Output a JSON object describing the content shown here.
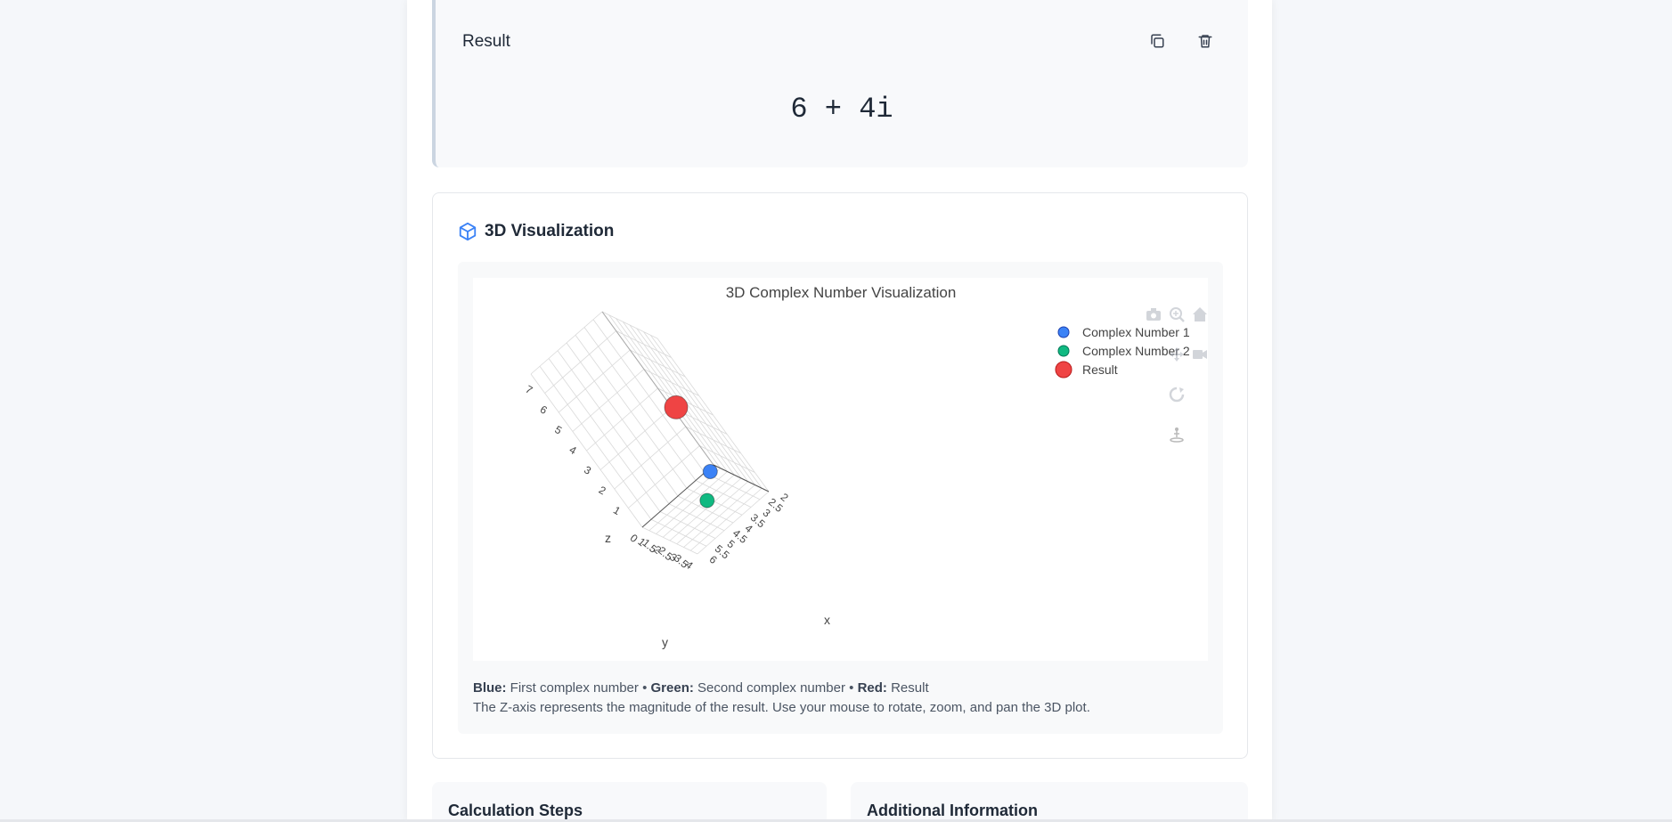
{
  "result": {
    "title": "Result",
    "value": "6 + 4i",
    "copy_icon": "copy-icon",
    "delete_icon": "trash-icon"
  },
  "visualization": {
    "title": "3D Visualization",
    "icon": "cube-icon",
    "caption": {
      "blue_label": "Blue:",
      "blue_text": "First complex number",
      "green_label": "Green:",
      "green_text": "Second complex number",
      "red_label": "Red:",
      "red_text": "Result",
      "separator": "•",
      "line2": "The Z-axis represents the magnitude of the result. Use your mouse to rotate, zoom, and pan the 3D plot."
    },
    "modebar": [
      "camera-icon",
      "zoom-icon",
      "home-icon",
      "pan-icon",
      "orbit-camera-icon",
      "turntable-rotate-icon",
      "reset-camera-icon"
    ]
  },
  "chart_data": {
    "type": "scatter3d",
    "title": "3D Complex Number Visualization",
    "axes": {
      "x": {
        "label": "x",
        "ticks": [
          "2",
          "2.5",
          "3",
          "3.5",
          "4",
          "4.5",
          "5",
          "5.5",
          "6"
        ]
      },
      "y": {
        "label": "y",
        "ticks": [
          "0",
          "1",
          "1.5",
          "2",
          "2.5",
          "3",
          "3.5",
          "4"
        ]
      },
      "z": {
        "label": "z",
        "ticks": [
          "1",
          "2",
          "3",
          "4",
          "5",
          "6",
          "7"
        ]
      }
    },
    "series": [
      {
        "name": "Complex Number 1",
        "color": "#3b82f6",
        "points": [
          {
            "x": 6,
            "y": 0,
            "z": 0
          }
        ]
      },
      {
        "name": "Complex Number 2",
        "color": "#10b981",
        "points": [
          {
            "x": 2,
            "y": 4,
            "z": 0
          }
        ]
      },
      {
        "name": "Result",
        "color": "#ef4444",
        "points": [
          {
            "x": 6,
            "y": 4,
            "z": 7.2
          }
        ]
      }
    ],
    "legend_position": "top-right",
    "grid": true
  },
  "steps": {
    "title": "Calculation Steps"
  },
  "info": {
    "title": "Additional Information"
  }
}
